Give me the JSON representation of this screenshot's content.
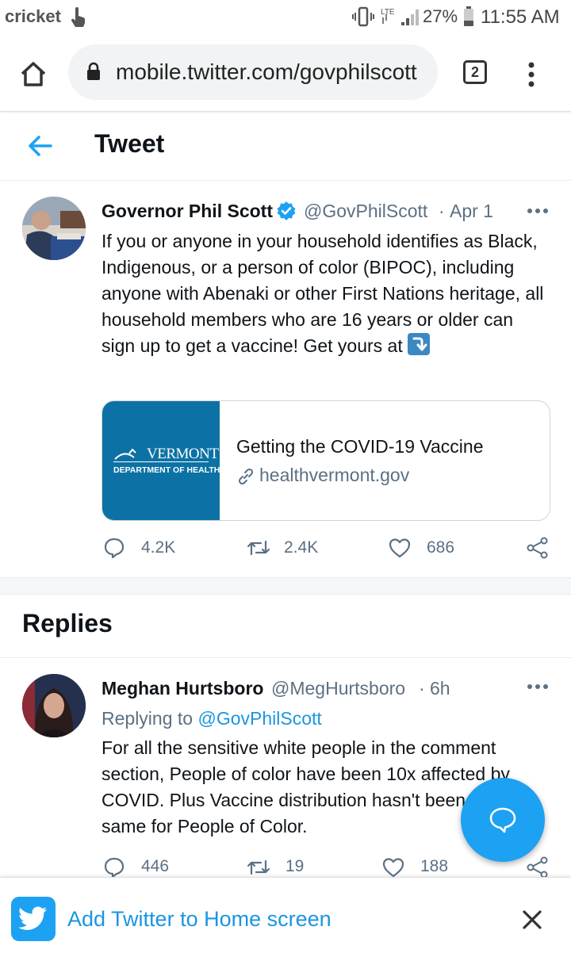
{
  "status_bar": {
    "carrier": "cricket",
    "network": "LTE",
    "battery": "27%",
    "time": "11:55 AM"
  },
  "browser": {
    "url": "mobile.twitter.com/govphilscott",
    "tab_count": "2"
  },
  "header": {
    "title": "Tweet"
  },
  "tweet": {
    "author_name": "Governor Phil Scott",
    "handle": "@GovPhilScott",
    "separator": "·",
    "date": "Apr 1",
    "text": "If you or anyone in your household identifies as Black, Indigenous, or a person of color (BIPOC), including anyone with Abenaki or other First Nations heritage, all household members who are 16 years or older can sign up to get a vaccine! Get yours at",
    "card": {
      "logo_word": "VERMONT",
      "logo_subtitle": "DEPARTMENT OF HEALTH",
      "title": "Getting the COVID-19 Vaccine",
      "domain": "healthvermont.gov"
    },
    "replies": "4.2K",
    "retweets": "2.4K",
    "likes": "686"
  },
  "replies_section": {
    "heading": "Replies"
  },
  "reply": {
    "author_name": "Meghan Hurtsboro",
    "handle": "@MegHurtsboro",
    "separator": "·",
    "time": "6h",
    "replying_prefix": "Replying to",
    "replying_to": "@GovPhilScott",
    "text": "For all the sensitive white people in the comment section, People of color have been 10x affected by COVID. Plus Vaccine distribution hasn't been the same for People of Color.",
    "replies": "446",
    "retweets": "19",
    "likes": "188"
  },
  "banner": {
    "text": "Add Twitter to Home screen"
  },
  "colors": {
    "twitter_blue": "#1da1f2",
    "link_blue": "#1b95e0",
    "secondary_text": "#5b7083",
    "vermont_blue": "#0c72a5"
  }
}
